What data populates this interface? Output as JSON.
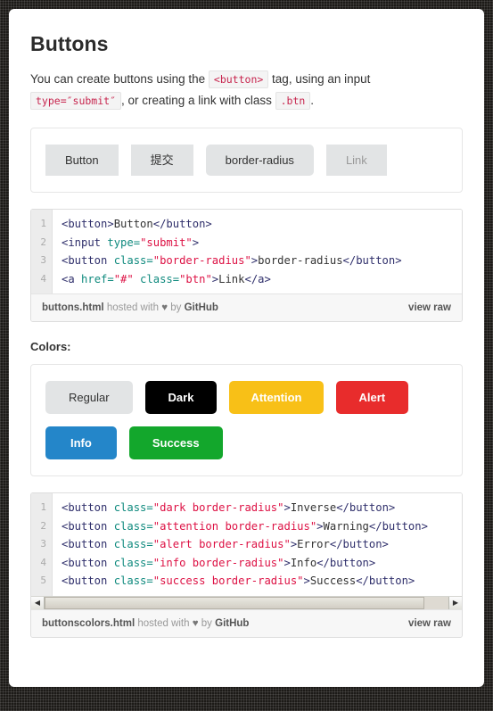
{
  "page": {
    "title": "Buttons",
    "intro": {
      "part1": "You can create buttons using the ",
      "code1": "<button>",
      "part2": " tag, using an input ",
      "code2": "type=″submit″",
      "part3": ", or creating a link with class ",
      "code3": ".btn",
      "part4": "."
    },
    "colors_label": "Colors:"
  },
  "demo_buttons": {
    "basic": [
      {
        "label": "Button",
        "style": "square"
      },
      {
        "label": "提交",
        "style": "square"
      },
      {
        "label": "border-radius",
        "style": "radius"
      },
      {
        "label": "Link",
        "style": "link"
      }
    ],
    "colored_row1": [
      {
        "label": "Regular",
        "style": "regular",
        "color": "#e2e4e5"
      },
      {
        "label": "Dark",
        "style": "dark",
        "color": "#000000"
      },
      {
        "label": "Attention",
        "style": "attention",
        "color": "#f8c017"
      },
      {
        "label": "Alert",
        "style": "alert",
        "color": "#e82c2c"
      }
    ],
    "colored_row2": [
      {
        "label": "Info",
        "style": "info",
        "color": "#2486c9"
      },
      {
        "label": "Success",
        "style": "success",
        "color": "#13a72c"
      }
    ]
  },
  "gists": [
    {
      "line_numbers": [
        "1",
        "2",
        "3",
        "4"
      ],
      "lines": [
        [
          {
            "t": "tag",
            "v": "<button>"
          },
          {
            "t": "txt",
            "v": "Button"
          },
          {
            "t": "tag",
            "v": "</button>"
          }
        ],
        [
          {
            "t": "tag",
            "v": "<input "
          },
          {
            "t": "attr",
            "v": "type="
          },
          {
            "t": "str",
            "v": "\"submit\""
          },
          {
            "t": "tag",
            "v": ">"
          }
        ],
        [
          {
            "t": "tag",
            "v": "<button "
          },
          {
            "t": "attr",
            "v": "class="
          },
          {
            "t": "str",
            "v": "\"border-radius\""
          },
          {
            "t": "tag",
            "v": ">"
          },
          {
            "t": "txt",
            "v": "border-radius"
          },
          {
            "t": "tag",
            "v": "</button>"
          }
        ],
        [
          {
            "t": "tag",
            "v": "<a "
          },
          {
            "t": "attr",
            "v": "href="
          },
          {
            "t": "str",
            "v": "\"#\""
          },
          {
            "t": "attr",
            "v": " class="
          },
          {
            "t": "str",
            "v": "\"btn\""
          },
          {
            "t": "tag",
            "v": ">"
          },
          {
            "t": "txt",
            "v": "Link"
          },
          {
            "t": "tag",
            "v": "</a>"
          }
        ]
      ],
      "has_scrollbar": false,
      "filename": "buttons.html",
      "hosted_with": "hosted with",
      "heart": "♥",
      "by": "by",
      "host": "GitHub",
      "view_raw": "view raw"
    },
    {
      "line_numbers": [
        "1",
        "2",
        "3",
        "4",
        "5"
      ],
      "lines": [
        [
          {
            "t": "tag",
            "v": "<button "
          },
          {
            "t": "attr",
            "v": "class="
          },
          {
            "t": "str",
            "v": "\"dark border-radius\""
          },
          {
            "t": "tag",
            "v": ">"
          },
          {
            "t": "txt",
            "v": "Inverse"
          },
          {
            "t": "tag",
            "v": "</button>"
          }
        ],
        [
          {
            "t": "tag",
            "v": "<button "
          },
          {
            "t": "attr",
            "v": "class="
          },
          {
            "t": "str",
            "v": "\"attention border-radius\""
          },
          {
            "t": "tag",
            "v": ">"
          },
          {
            "t": "txt",
            "v": "Warning"
          },
          {
            "t": "tag",
            "v": "</button>"
          }
        ],
        [
          {
            "t": "tag",
            "v": "<button "
          },
          {
            "t": "attr",
            "v": "class="
          },
          {
            "t": "str",
            "v": "\"alert border-radius\""
          },
          {
            "t": "tag",
            "v": ">"
          },
          {
            "t": "txt",
            "v": "Error"
          },
          {
            "t": "tag",
            "v": "</button>"
          }
        ],
        [
          {
            "t": "tag",
            "v": "<button "
          },
          {
            "t": "attr",
            "v": "class="
          },
          {
            "t": "str",
            "v": "\"info border-radius\""
          },
          {
            "t": "tag",
            "v": ">"
          },
          {
            "t": "txt",
            "v": "Info"
          },
          {
            "t": "tag",
            "v": "</button>"
          }
        ],
        [
          {
            "t": "tag",
            "v": "<button "
          },
          {
            "t": "attr",
            "v": "class="
          },
          {
            "t": "str",
            "v": "\"success border-radius\""
          },
          {
            "t": "tag",
            "v": ">"
          },
          {
            "t": "txt",
            "v": "Success"
          },
          {
            "t": "tag",
            "v": "</button>"
          }
        ]
      ],
      "has_scrollbar": true,
      "scroll_left_arrow": "◀",
      "scroll_right_arrow": "▶",
      "filename": "buttonscolors.html",
      "hosted_with": "hosted with",
      "heart": "♥",
      "by": "by",
      "host": "GitHub",
      "view_raw": "view raw"
    }
  ]
}
